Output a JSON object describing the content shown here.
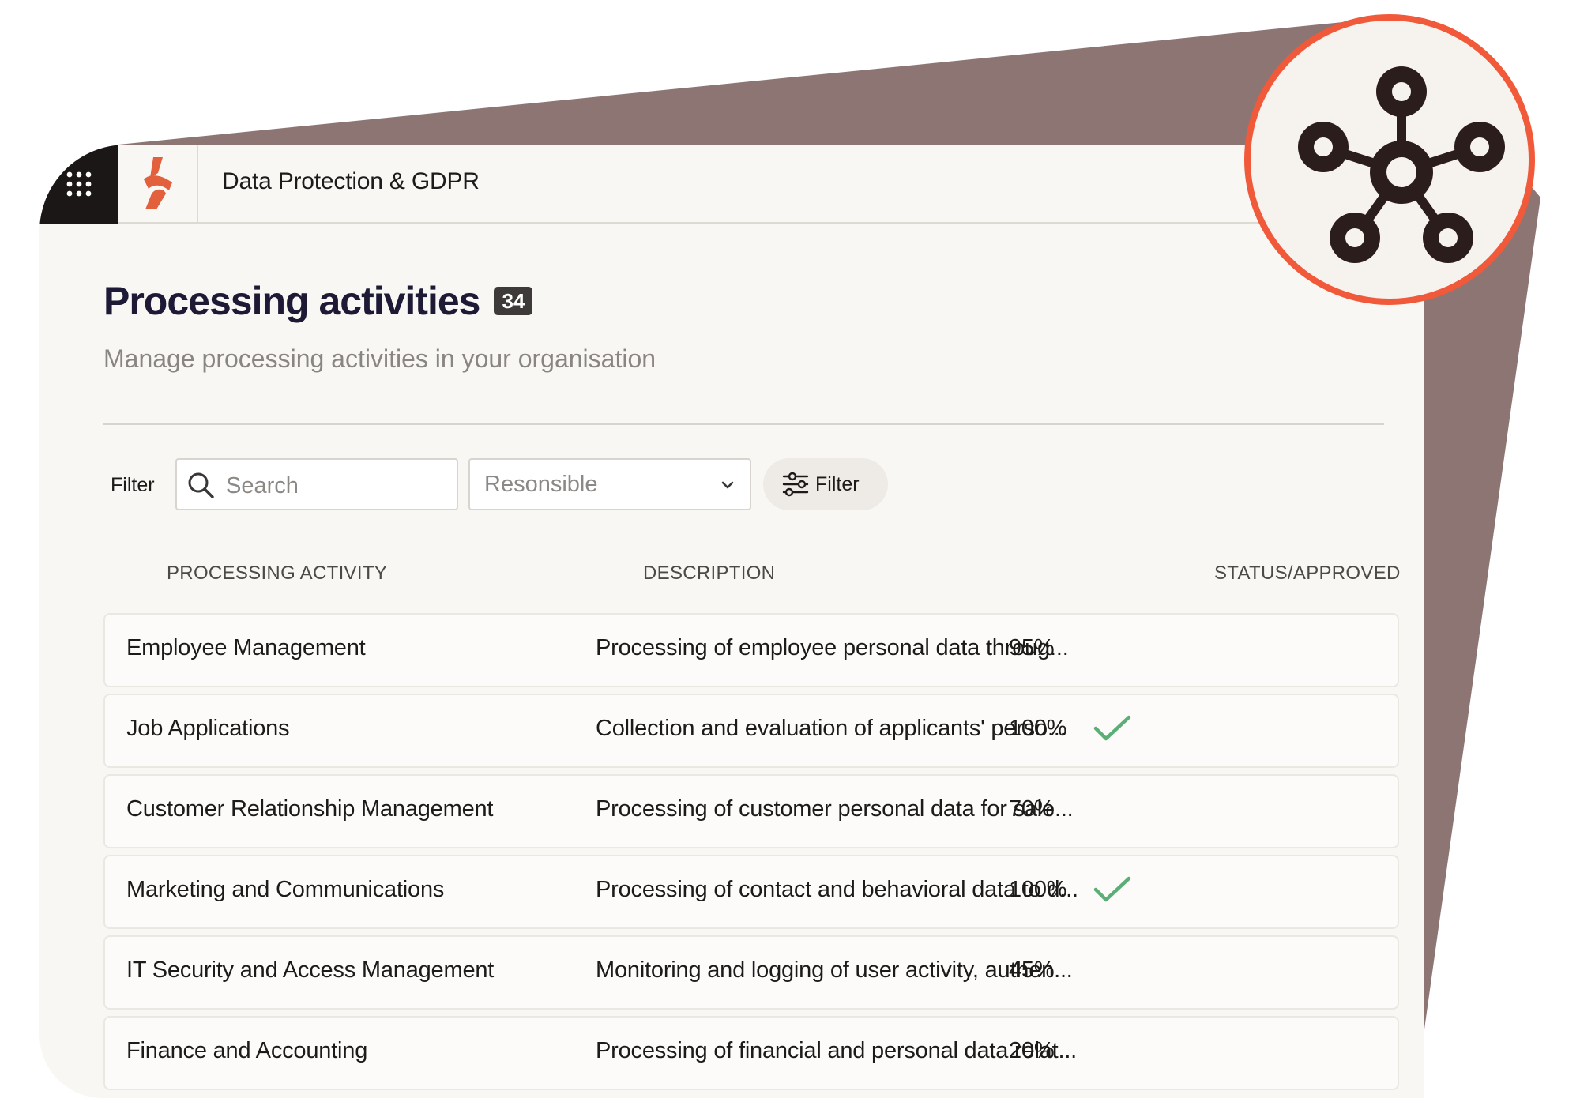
{
  "app": {
    "title": "Data Protection & GDPR"
  },
  "icons": {
    "apps": "apps-grid-icon",
    "logo": "brand-logo",
    "search": "search-icon",
    "dropdown": "chevron-down-icon",
    "filter": "sliders-icon",
    "approved": "checkmark-icon",
    "badge": "network-icon"
  },
  "colors": {
    "accent": "#f05a3a",
    "logo": "#e3603c",
    "backdrop": "#8d7574",
    "dark": "#1b1717",
    "check": "#5cae77"
  },
  "page": {
    "title": "Processing activities",
    "count": "34",
    "subtitle": "Manage processing activities in your organisation"
  },
  "filters": {
    "label": "Filter",
    "search_placeholder": "Search",
    "responsible_value": "Resonsible",
    "button_label": "Filter"
  },
  "table": {
    "columns": [
      "PROCESSING ACTIVITY",
      "DESCRIPTION",
      "STATUS/APPROVED"
    ],
    "rows": [
      {
        "activity": "Employee Management",
        "description": "Processing of employee personal data throug...",
        "status": "95%",
        "approved": false
      },
      {
        "activity": "Job Applications",
        "description": "Collection and evaluation of applicants' perso...",
        "status": "100%",
        "approved": true
      },
      {
        "activity": "Customer Relationship Management",
        "description": "Processing of customer personal data for sale...",
        "status": "70%",
        "approved": false
      },
      {
        "activity": "Marketing and Communications",
        "description": "Processing of contact and behavioral data to d...",
        "status": "100%",
        "approved": true
      },
      {
        "activity": "IT Security and Access Management",
        "description": "Monitoring and logging of user activity, authen...",
        "status": "45%",
        "approved": false
      },
      {
        "activity": "Finance and Accounting",
        "description": "Processing of financial and personal data relat...",
        "status": "20%",
        "approved": false
      }
    ]
  }
}
